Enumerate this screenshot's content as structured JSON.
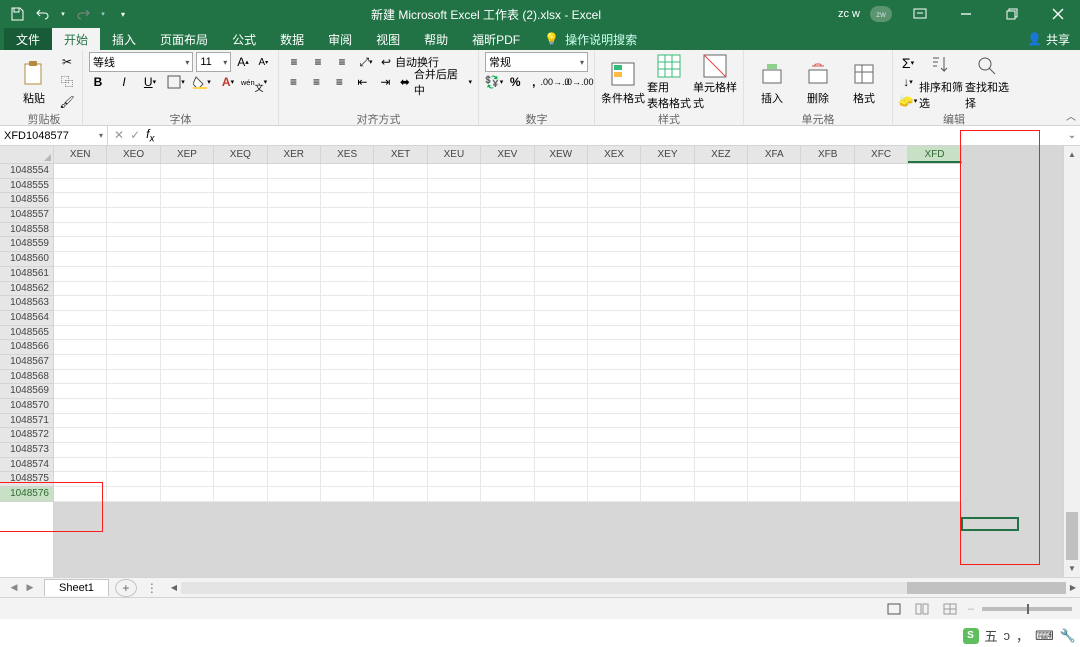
{
  "title": "新建 Microsoft Excel 工作表 (2).xlsx - Excel",
  "user_name": "zc w",
  "user_initials": "zw",
  "tabs": {
    "file": "文件",
    "home": "开始",
    "insert": "插入",
    "layout": "页面布局",
    "formulas": "公式",
    "data": "数据",
    "review": "审阅",
    "view": "视图",
    "help": "帮助",
    "foxit": "福昕PDF"
  },
  "tellme": "操作说明搜索",
  "share": "共享",
  "ribbon": {
    "clipboard": {
      "paste": "粘贴",
      "label": "剪贴板"
    },
    "font": {
      "name": "等线",
      "size": "11",
      "label": "字体"
    },
    "align": {
      "wrap": "自动换行",
      "merge": "合并后居中",
      "label": "对齐方式"
    },
    "number": {
      "format": "常规",
      "label": "数字"
    },
    "styles": {
      "cond": "条件格式",
      "tab": "套用\n表格格式",
      "cell": "单元格样式",
      "label": "样式"
    },
    "cells": {
      "ins": "插入",
      "del": "删除",
      "fmt": "格式",
      "label": "单元格"
    },
    "edit": {
      "sort": "排序和筛选",
      "find": "查找和选择",
      "label": "编辑"
    }
  },
  "name_box": "XFD1048577",
  "columns": [
    "XEN",
    "XEO",
    "XEP",
    "XEQ",
    "XER",
    "XES",
    "XET",
    "XEU",
    "XEV",
    "XEW",
    "XEX",
    "XEY",
    "XEZ",
    "XFA",
    "XFB",
    "XFC",
    "XFD"
  ],
  "active_col_index": 16,
  "rows": [
    1048554,
    1048555,
    1048556,
    1048557,
    1048558,
    1048559,
    1048560,
    1048561,
    1048562,
    1048563,
    1048564,
    1048565,
    1048566,
    1048567,
    1048568,
    1048569,
    1048570,
    1048571,
    1048572,
    1048573,
    1048574,
    1048575,
    1048576
  ],
  "active_row_index": 22,
  "sheet_name": "Sheet1",
  "ime": {
    "wubi": "五",
    "moon": "ɔ",
    "comma": "，",
    "kbd": "⌨",
    "wrench": "🔧"
  }
}
